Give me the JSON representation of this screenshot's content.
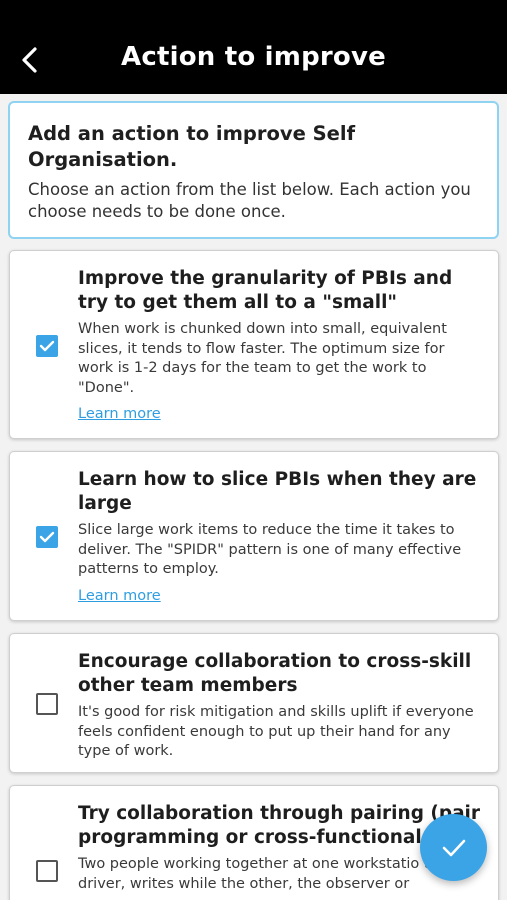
{
  "header": {
    "title": "Action to improve",
    "back_icon": "chevron-left-icon"
  },
  "intro": {
    "title": "Add an action to improve Self Organisation.",
    "description": "Choose an action from the list below. Each action you choose needs to be done once."
  },
  "actions": [
    {
      "title": "Improve the granularity of PBIs and try to get them all to a \"small\"",
      "description": "When work is chunked down into small, equivalent slices, it tends to flow faster. The optimum size for work is 1-2 days for the team to get the work to \"Done\".",
      "learn_more": "Learn more",
      "checked": true
    },
    {
      "title": "Learn how to slice PBIs when they are large",
      "description": "Slice large work items to reduce the time it takes to deliver. The \"SPIDR\" pattern is one of many effective patterns to employ.",
      "learn_more": "Learn more",
      "checked": true
    },
    {
      "title": "Encourage collaboration to cross-skill other team members",
      "description": "It's good for risk mitigation and skills uplift if everyone feels confident enough to put up their hand for any type of work.",
      "checked": false
    },
    {
      "title": "Try collaboration through pairing (pair programming or cross-functional p",
      "description": "Two people working together at one workstatio the driver, writes while the other, the observer or",
      "checked": false
    }
  ],
  "fab": {
    "icon": "checkmark-icon"
  },
  "colors": {
    "accent": "#3aa4e6",
    "appbar": "#000000",
    "intro_border": "#8fd3f2",
    "link": "#2f9ee0"
  }
}
